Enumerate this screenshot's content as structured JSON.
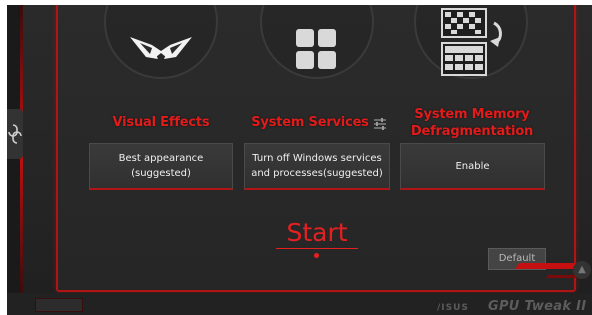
{
  "options": {
    "visual_effects": {
      "title": "Visual Effects",
      "value": "Best appearance\n(suggested)",
      "icon": "rog-eyes-icon"
    },
    "system_services": {
      "title": "System Services",
      "value": "Turn off Windows services\nand processes(suggested)",
      "icon": "windows-tiles-icon"
    },
    "memory_defrag": {
      "title": "System Memory\nDefragmentation",
      "value": "Enable",
      "icon": "memory-grid-icon"
    }
  },
  "actions": {
    "start_label": "Start",
    "default_label": "Default"
  },
  "footer": {
    "brand": "/ISUS",
    "product": "GPU Tweak II"
  },
  "colors": {
    "accent": "#e21b1b",
    "background": "#262626",
    "panel_border": "#b01515"
  }
}
